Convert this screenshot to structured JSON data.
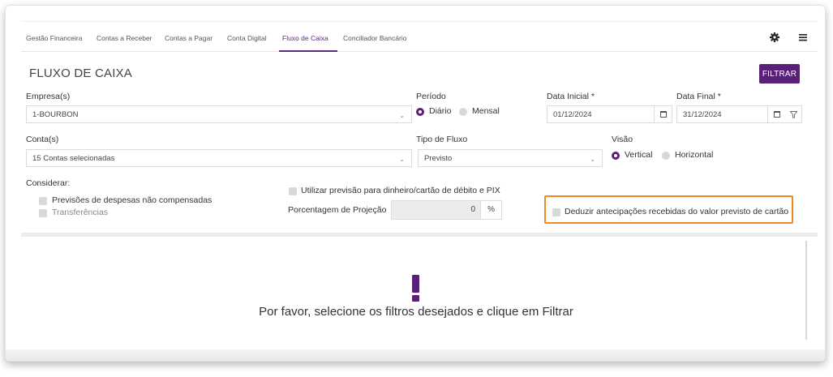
{
  "nav": {
    "tabs": [
      {
        "label": "Gestão Financeira"
      },
      {
        "label": "Contas a Receber"
      },
      {
        "label": "Contas a Pagar"
      },
      {
        "label": "Conta Digital"
      },
      {
        "label": "Fluxo de Caixa"
      },
      {
        "label": "Conciliador Bancário"
      }
    ],
    "active_tab": "Fluxo de Caixa",
    "icons": [
      "gear-icon",
      "menu-icon"
    ]
  },
  "panel": {
    "title": "FLUXO DE CAIXA",
    "filter_button": "FILTRAR"
  },
  "form": {
    "empresa": {
      "label": "Empresa(s)",
      "value": "1-BOURBON"
    },
    "periodo": {
      "label": "Período",
      "options": [
        "Diário",
        "Mensal"
      ],
      "selected": "Diário"
    },
    "data_inicial": {
      "label": "Data Inicial *",
      "value": "01/12/2024"
    },
    "data_final": {
      "label": "Data Final *",
      "value": "31/12/2024"
    },
    "conta": {
      "label": "Conta(s)",
      "value": "15 Contas selecionadas"
    },
    "tipo_fluxo": {
      "label": "Tipo de Fluxo",
      "value": "Previsto"
    },
    "visao": {
      "label": "Visão",
      "options": [
        "Vertical",
        "Horizontal"
      ],
      "selected": "Vertical"
    },
    "considerar": {
      "label": "Considerar:",
      "options": [
        "Previsões de despesas não compensadas",
        "Transferências"
      ]
    },
    "utilizar_previsao": {
      "label": "Utilizar previsão para dinheiro/cartão de débito e PIX"
    },
    "porcentagem": {
      "label": "Porcentagem de Projeção",
      "value": "0",
      "unit": "%"
    },
    "deduzir": {
      "label": "Deduzir antecipações recebidas do valor previsto de cartão"
    }
  },
  "empty_state": {
    "message": "Por favor, selecione os filtros desejados e clique em Filtrar"
  },
  "colors": {
    "accent": "#5a1f78",
    "highlight": "#f08a24",
    "field_border": "#dcdcdc"
  }
}
